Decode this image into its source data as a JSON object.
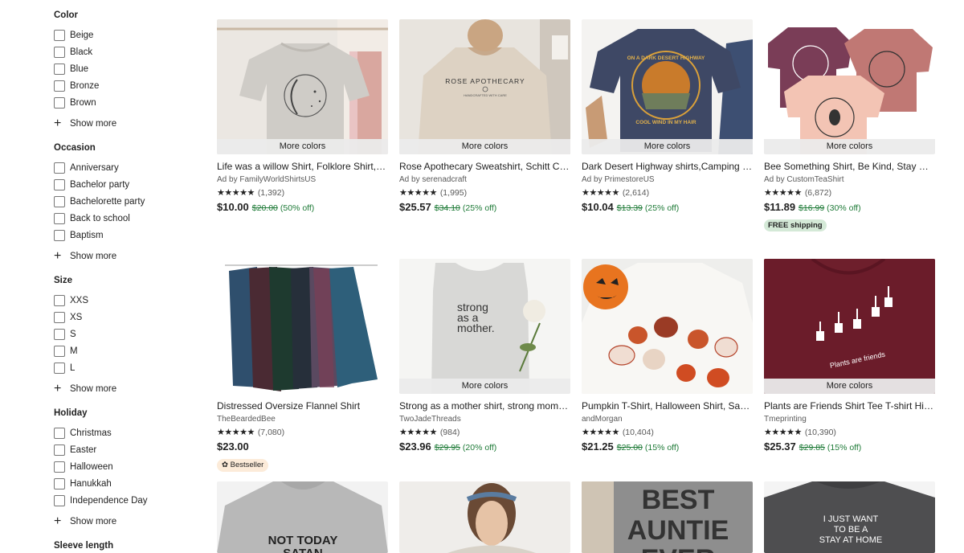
{
  "filters": [
    {
      "title": "Color",
      "options": [
        "Beige",
        "Black",
        "Blue",
        "Bronze",
        "Brown"
      ],
      "show_more": "Show more"
    },
    {
      "title": "Occasion",
      "options": [
        "Anniversary",
        "Bachelor party",
        "Bachelorette party",
        "Back to school",
        "Baptism"
      ],
      "show_more": "Show more"
    },
    {
      "title": "Size",
      "options": [
        "XXS",
        "XS",
        "S",
        "M",
        "L"
      ],
      "show_more": "Show more"
    },
    {
      "title": "Holiday",
      "options": [
        "Christmas",
        "Easter",
        "Halloween",
        "Hanukkah",
        "Independence Day"
      ],
      "show_more": "Show more"
    },
    {
      "title": "Sleeve length",
      "options": [],
      "show_more": ""
    }
  ],
  "listings": [
    {
      "title": "Life was a willow Shirt, Folklore Shirt, Taylor Swift Shirt",
      "shop": "Ad by FamilyWorldShirtsUS",
      "stars": "★★★★★",
      "reviews": "(1,392)",
      "price": "$10.00",
      "orig": "$20.00",
      "off": "(50% off)",
      "more_colors": "More colors",
      "badge": ""
    },
    {
      "title": "Rose Apothecary Sweatshirt, Schitt Creek Sweatshirt",
      "shop": "Ad by serenadcraft",
      "stars": "★★★★★",
      "reviews": "(1,995)",
      "price": "$25.57",
      "orig": "$34.10",
      "off": "(25% off)",
      "more_colors": "More colors",
      "badge": ""
    },
    {
      "title": "Dark Desert Highway shirts,Camping Shirt",
      "shop": "Ad by PrimestoreUS",
      "stars": "★★★★★",
      "reviews": "(2,614)",
      "price": "$10.04",
      "orig": "$13.39",
      "off": "(25% off)",
      "more_colors": "More colors",
      "badge": ""
    },
    {
      "title": "Bee Something Shirt, Be Kind, Stay Humble Shirt",
      "shop": "Ad by CustomTeaShirt",
      "stars": "★★★★★",
      "reviews": "(6,872)",
      "price": "$11.89",
      "orig": "$16.99",
      "off": "(30% off)",
      "more_colors": "More colors",
      "badge": "FREE shipping"
    },
    {
      "title": "Distressed Oversize Flannel Shirt",
      "shop": "TheBeardedBee",
      "stars": "★★★★★",
      "reviews": "(7,080)",
      "price": "$23.00",
      "orig": "",
      "off": "",
      "more_colors": "",
      "badge": "Bestseller"
    },
    {
      "title": "Strong as a mother shirt, strong mom shirt",
      "shop": "TwoJadeThreads",
      "stars": "★★★★★",
      "reviews": "(984)",
      "price": "$23.96",
      "orig": "$29.95",
      "off": "(20% off)",
      "more_colors": "More colors",
      "badge": ""
    },
    {
      "title": "Pumpkin T-Shirt, Halloween Shirt, Sack Little",
      "shop": "andMorgan",
      "stars": "★★★★★",
      "reviews": "(10,404)",
      "price": "$21.25",
      "orig": "$25.00",
      "off": "(15% off)",
      "more_colors": "",
      "badge": ""
    },
    {
      "title": "Plants are Friends Shirt Tee T-shirt Hipster",
      "shop": "Tmeprinting",
      "stars": "★★★★★",
      "reviews": "(10,390)",
      "price": "$25.37",
      "orig": "$29.85",
      "off": "(15% off)",
      "more_colors": "More colors",
      "badge": ""
    }
  ],
  "image_text": {
    "rose": "ROSE APOTHECARY",
    "rose_sub": "HANDCRAFTED WITH CARE",
    "desert_top": "ON A DARK DESERT HIGHWAY",
    "desert_bottom": "COOL WIND IN MY HAIR",
    "strong_1": "strong",
    "strong_2": "as a",
    "strong_3": "mother.",
    "plants": "Plants are friends",
    "nt_1": "NOT TODAY",
    "nt_2": "SATAN",
    "best_1": "BEST",
    "best_2": "AUNTIE",
    "best_3": "EVER",
    "home_1": "I JUST WANT",
    "home_2": "TO BE A",
    "home_3": "STAY AT HOME"
  },
  "colors": {
    "sale_green": "#1e7a37",
    "free_ship_bg": "#d4e9d7",
    "bestseller_bg": "#fcebd9"
  }
}
